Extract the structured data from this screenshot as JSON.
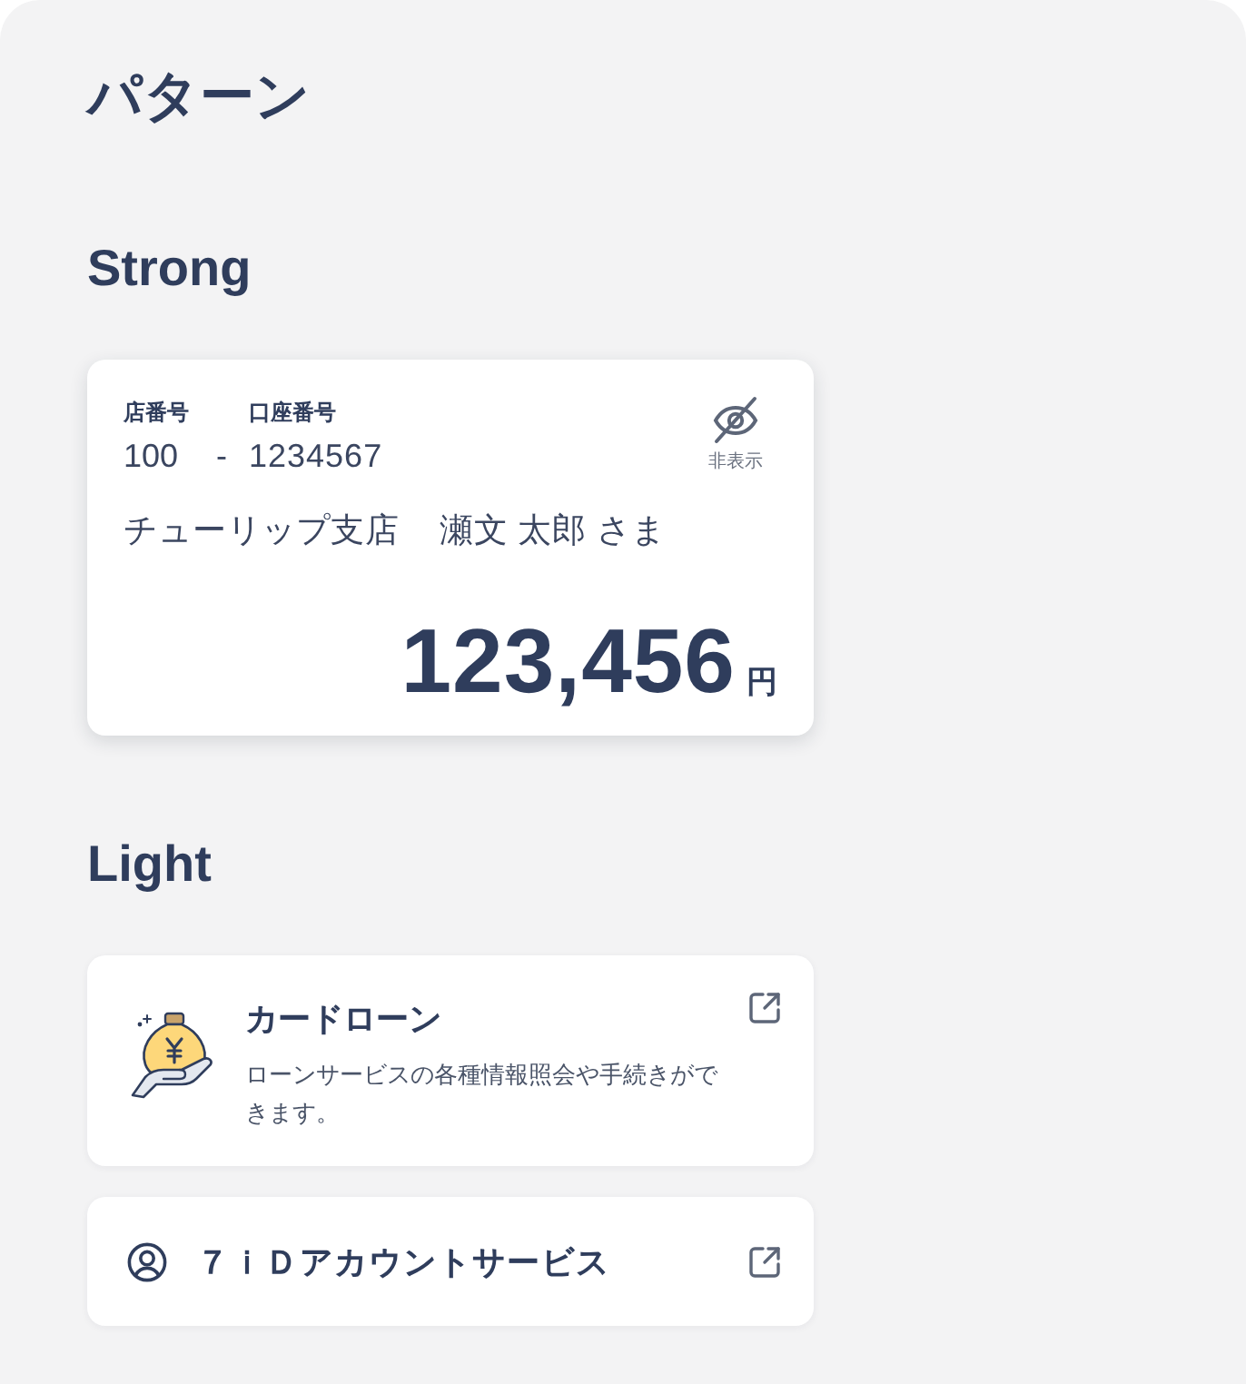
{
  "title": "パターン",
  "strong": {
    "heading": "Strong",
    "account_card": {
      "branch_label": "店番号",
      "branch_number": "100",
      "separator": "-",
      "account_label": "口座番号",
      "account_number": "1234567",
      "hide_button": {
        "label": "非表示"
      },
      "branch_name": "チューリップ支店",
      "customer_name": "瀬文 太郎 さま",
      "balance": "123,456",
      "currency": "円"
    }
  },
  "light": {
    "heading": "Light",
    "links": [
      {
        "kind": "illustrated",
        "title": "カードローン",
        "description": "ローンサービスの各種情報照会や手続きができます。"
      },
      {
        "kind": "account",
        "title": "７ｉＤアカウントサービス"
      }
    ]
  }
}
